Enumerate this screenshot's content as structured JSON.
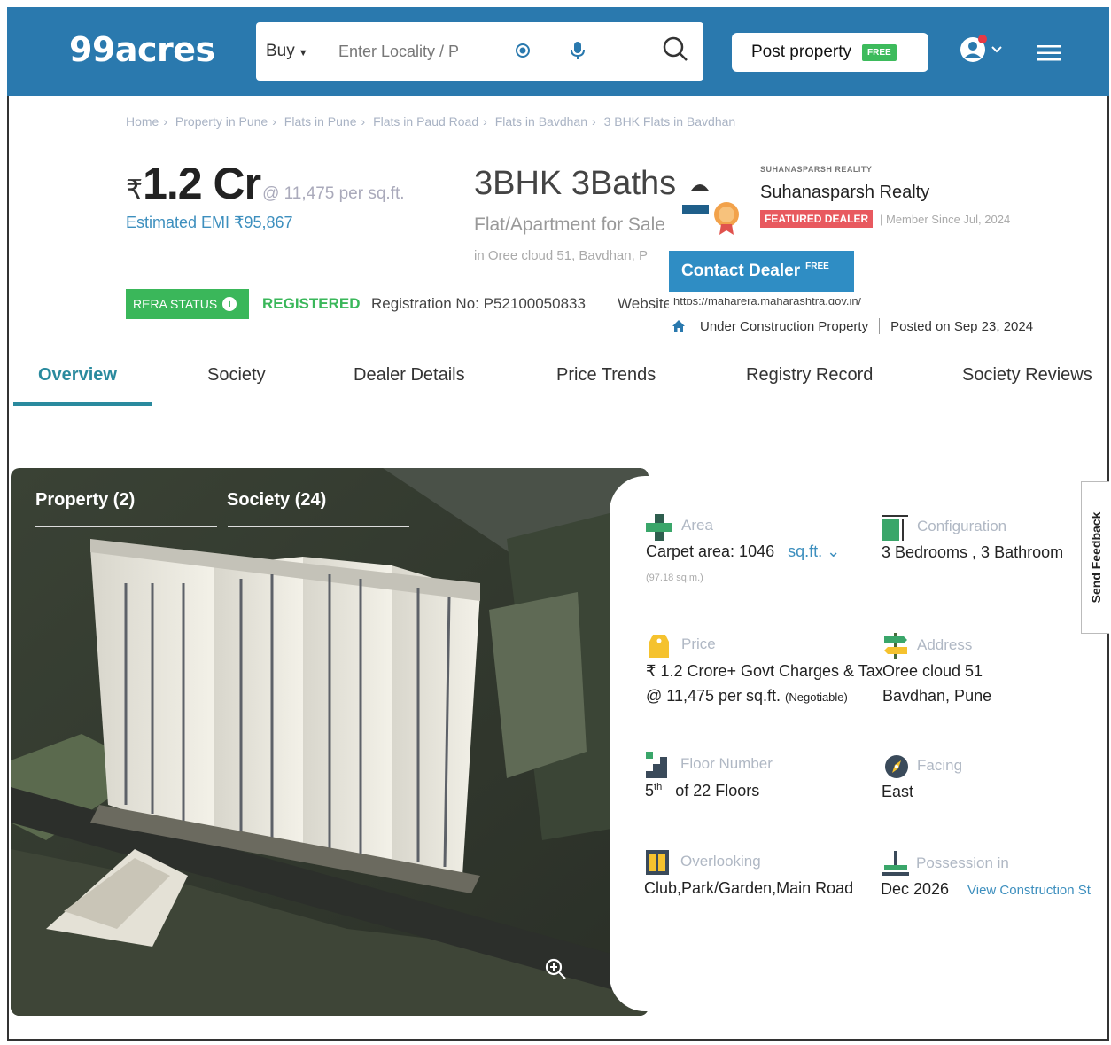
{
  "header": {
    "logo": "99acres",
    "buy_label": "Buy",
    "search_placeholder": "Enter Locality / P",
    "post_property_label": "Post property",
    "free_tag": "FREE",
    "brand_color": "#2a79ae"
  },
  "breadcrumb": [
    "Home",
    "Property in Pune",
    "Flats in Pune",
    "Flats in Paud Road",
    "Flats in Bavdhan",
    "3 BHK Flats in Bavdhan"
  ],
  "listing": {
    "currency": "₹",
    "price": "1.2 Cr",
    "price_per_sqft": "@ 11,475 per sq.ft.",
    "emi": "Estimated EMI ₹95,867",
    "title": "3BHK 3Baths",
    "subtitle": "Flat/Apartment for Sale",
    "location": "in Oree cloud 51, Bavdhan, P"
  },
  "dealer": {
    "small_label": "SUHANASPARSH REALITY",
    "name": "Suhanasparsh Realty",
    "badge": "FEATURED DEALER",
    "member_since": "| Member Since Jul, 2024",
    "contact_label": "Contact Dealer",
    "contact_free": "FREE"
  },
  "rera": {
    "badge": "RERA STATUS",
    "info": "i",
    "status": "REGISTERED",
    "reg_no": "Registration No: P52100050833",
    "website_label": "Website:",
    "website_value": "https://maharera.maharashtra.gov.in/"
  },
  "status": {
    "construction": "Under Construction Property",
    "posted": "Posted on Sep 23, 2024"
  },
  "tabs": [
    "Overview",
    "Society",
    "Dealer Details",
    "Price Trends",
    "Registry Record",
    "Society Reviews"
  ],
  "gallery": {
    "tabs": [
      "Property (2)",
      "Society (24)"
    ]
  },
  "details": {
    "area": {
      "label": "Area",
      "value": "Carpet area: 1046",
      "unit": "sq.ft.",
      "sub": "(97.18 sq.m.)"
    },
    "configuration": {
      "label": "Configuration",
      "value": "3 Bedrooms , 3 Bathroom"
    },
    "price": {
      "label": "Price",
      "line1": "₹ 1.2 Crore+ Govt Charges & Tax",
      "line2": "@ 11,475 per sq.ft.",
      "line2_small": "(Negotiable)"
    },
    "address": {
      "label": "Address",
      "line1": "Oree cloud 51",
      "line2": "Bavdhan, Pune"
    },
    "floor": {
      "label": "Floor Number",
      "value_num": "5",
      "value_sup": "th",
      "value_rest": "of 22 Floors"
    },
    "facing": {
      "label": "Facing",
      "value": "East"
    },
    "overlooking": {
      "label": "Overlooking",
      "value": "Club,Park/Garden,Main Road"
    },
    "possession": {
      "label": "Possession in",
      "value": "Dec 2026",
      "link": "View Construction St"
    }
  },
  "feedback": "Send Feedback"
}
